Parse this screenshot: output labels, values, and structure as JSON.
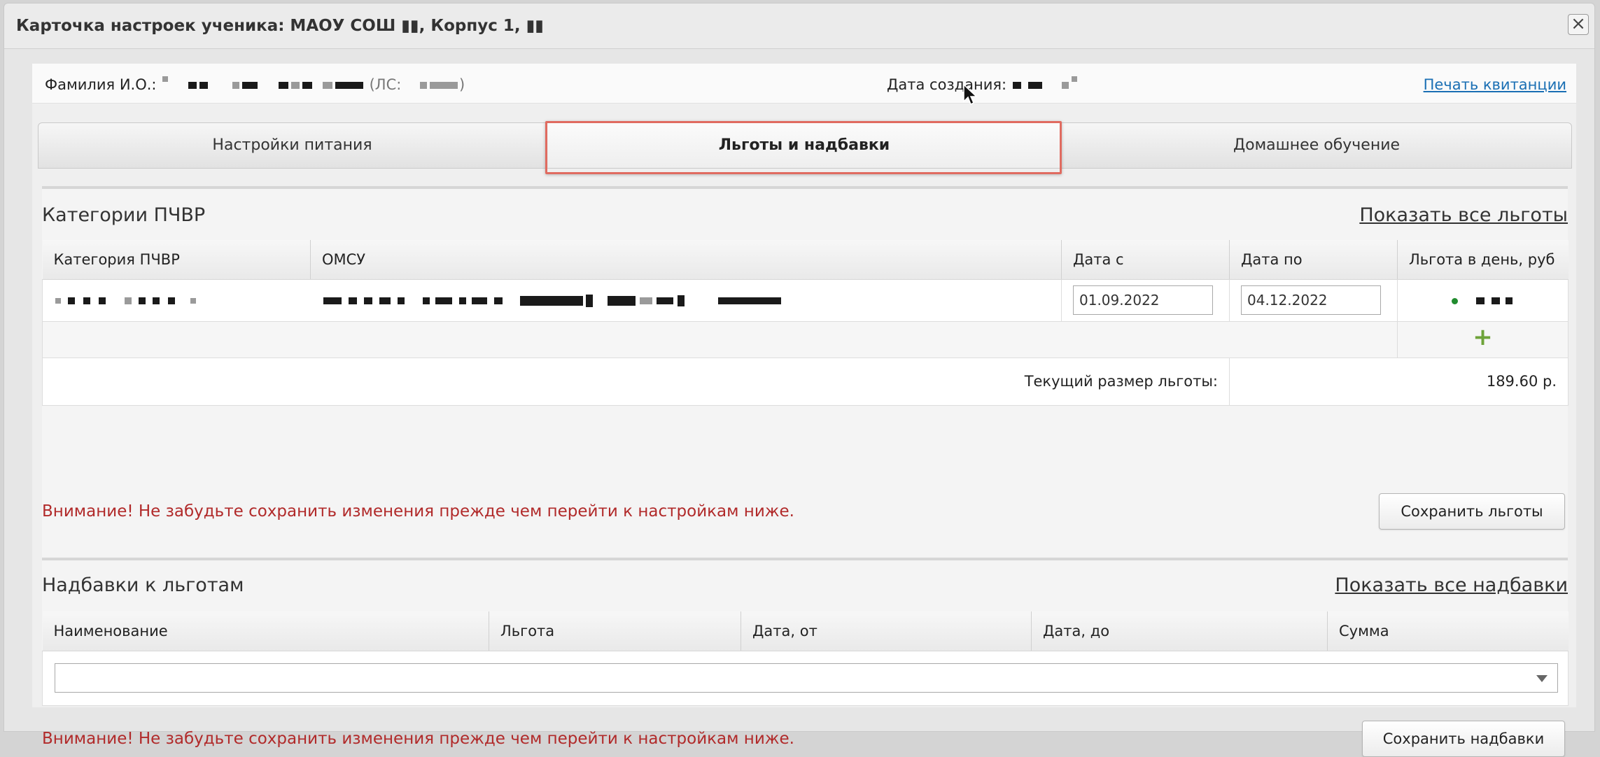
{
  "dialog": {
    "title": "Карточка настроек ученика: МАОУ СОШ ▮▮, Корпус 1, ▮▮",
    "close_icon": "close-icon"
  },
  "info": {
    "fio_label": "Фамилия И.О.:",
    "ls_open": "(ЛС:",
    "ls_close": ")",
    "created_label": "Дата создания:",
    "print_link": "Печать квитанции"
  },
  "tabs": [
    {
      "label": "Настройки питания",
      "active": false
    },
    {
      "label": "Льготы и надбавки",
      "active": true
    },
    {
      "label": "Домашнее обучение",
      "active": false
    }
  ],
  "benefits": {
    "title": "Категории ПЧВР",
    "show_all": "Показать все льготы",
    "columns": [
      "Категория ПЧВР",
      "ОМСУ",
      "Дата с",
      "Дата по",
      "Льгота в день, руб"
    ],
    "rows": [
      {
        "date_from": "01.09.2022",
        "date_to": "04.12.2022"
      }
    ],
    "add_icon": "plus-icon",
    "current_label": "Текущий размер льготы:",
    "current_value": "189.60 р.",
    "warning": "Внимание! Не забудьте сохранить изменения прежде чем перейти к настройкам ниже.",
    "save_button": "Сохранить льготы"
  },
  "allowances": {
    "title": "Надбавки к льготам",
    "show_all": "Показать все надбавки",
    "columns": [
      "Наименование",
      "Льгота",
      "Дата, от",
      "Дата, до",
      "Сумма"
    ],
    "select_value": "",
    "warning": "Внимание! Не забудьте сохранить изменения прежде чем перейти к настройкам ниже.",
    "save_button": "Сохранить надбавки"
  }
}
